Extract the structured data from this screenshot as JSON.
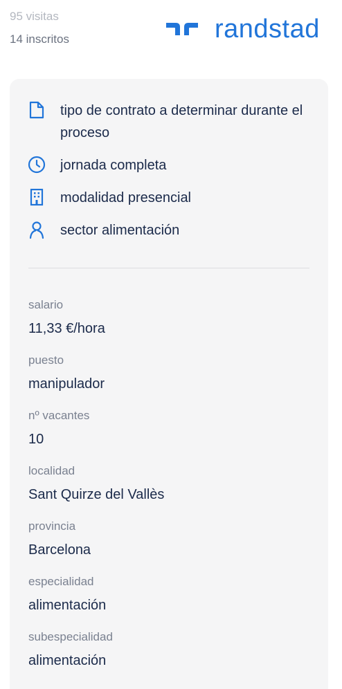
{
  "header": {
    "visits": "95 visitas",
    "inscribed": "14 inscritos",
    "logo_text": "randstad",
    "logo_color": "#2175d9"
  },
  "features": [
    {
      "icon": "document-icon",
      "text": "tipo de contrato a determinar durante el proceso"
    },
    {
      "icon": "clock-icon",
      "text": "jornada completa"
    },
    {
      "icon": "building-icon",
      "text": "modalidad presencial"
    },
    {
      "icon": "person-icon",
      "text": "sector alimentación"
    }
  ],
  "details": [
    {
      "label": "salario",
      "value": "11,33 €/hora"
    },
    {
      "label": "puesto",
      "value": "manipulador"
    },
    {
      "label": "nº vacantes",
      "value": "10"
    },
    {
      "label": "localidad",
      "value": "Sant Quirze del Vallès"
    },
    {
      "label": "provincia",
      "value": "Barcelona"
    },
    {
      "label": "especialidad",
      "value": "alimentación"
    },
    {
      "label": "subespecialidad",
      "value": "alimentación"
    }
  ],
  "colors": {
    "accent": "#2175d9",
    "card_bg": "#f5f5f6",
    "text": "#1b2a4a",
    "muted": "#7a8190"
  }
}
